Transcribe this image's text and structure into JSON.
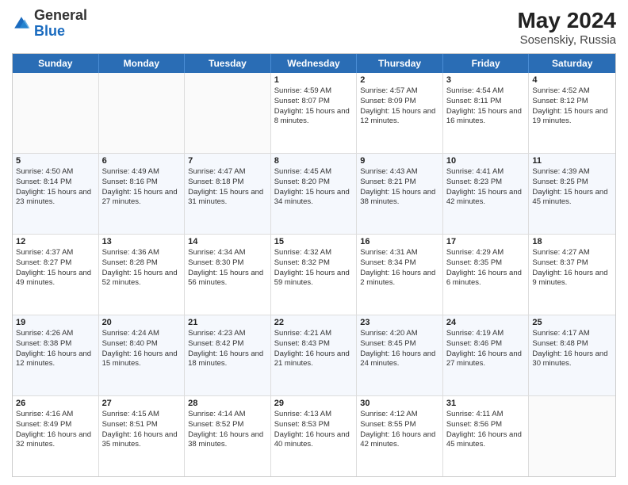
{
  "header": {
    "logo_general": "General",
    "logo_blue": "Blue",
    "month_year": "May 2024",
    "location": "Sosenskiy, Russia"
  },
  "calendar": {
    "days_of_week": [
      "Sunday",
      "Monday",
      "Tuesday",
      "Wednesday",
      "Thursday",
      "Friday",
      "Saturday"
    ],
    "rows": [
      {
        "alt": false,
        "cells": [
          {
            "day": "",
            "empty": true
          },
          {
            "day": "",
            "empty": true
          },
          {
            "day": "",
            "empty": true
          },
          {
            "day": "1",
            "sunrise": "4:59 AM",
            "sunset": "8:07 PM",
            "daylight": "15 hours and 8 minutes."
          },
          {
            "day": "2",
            "sunrise": "4:57 AM",
            "sunset": "8:09 PM",
            "daylight": "15 hours and 12 minutes."
          },
          {
            "day": "3",
            "sunrise": "4:54 AM",
            "sunset": "8:11 PM",
            "daylight": "15 hours and 16 minutes."
          },
          {
            "day": "4",
            "sunrise": "4:52 AM",
            "sunset": "8:12 PM",
            "daylight": "15 hours and 19 minutes."
          }
        ]
      },
      {
        "alt": true,
        "cells": [
          {
            "day": "5",
            "sunrise": "4:50 AM",
            "sunset": "8:14 PM",
            "daylight": "15 hours and 23 minutes."
          },
          {
            "day": "6",
            "sunrise": "4:49 AM",
            "sunset": "8:16 PM",
            "daylight": "15 hours and 27 minutes."
          },
          {
            "day": "7",
            "sunrise": "4:47 AM",
            "sunset": "8:18 PM",
            "daylight": "15 hours and 31 minutes."
          },
          {
            "day": "8",
            "sunrise": "4:45 AM",
            "sunset": "8:20 PM",
            "daylight": "15 hours and 34 minutes."
          },
          {
            "day": "9",
            "sunrise": "4:43 AM",
            "sunset": "8:21 PM",
            "daylight": "15 hours and 38 minutes."
          },
          {
            "day": "10",
            "sunrise": "4:41 AM",
            "sunset": "8:23 PM",
            "daylight": "15 hours and 42 minutes."
          },
          {
            "day": "11",
            "sunrise": "4:39 AM",
            "sunset": "8:25 PM",
            "daylight": "15 hours and 45 minutes."
          }
        ]
      },
      {
        "alt": false,
        "cells": [
          {
            "day": "12",
            "sunrise": "4:37 AM",
            "sunset": "8:27 PM",
            "daylight": "15 hours and 49 minutes."
          },
          {
            "day": "13",
            "sunrise": "4:36 AM",
            "sunset": "8:28 PM",
            "daylight": "15 hours and 52 minutes."
          },
          {
            "day": "14",
            "sunrise": "4:34 AM",
            "sunset": "8:30 PM",
            "daylight": "15 hours and 56 minutes."
          },
          {
            "day": "15",
            "sunrise": "4:32 AM",
            "sunset": "8:32 PM",
            "daylight": "15 hours and 59 minutes."
          },
          {
            "day": "16",
            "sunrise": "4:31 AM",
            "sunset": "8:34 PM",
            "daylight": "16 hours and 2 minutes."
          },
          {
            "day": "17",
            "sunrise": "4:29 AM",
            "sunset": "8:35 PM",
            "daylight": "16 hours and 6 minutes."
          },
          {
            "day": "18",
            "sunrise": "4:27 AM",
            "sunset": "8:37 PM",
            "daylight": "16 hours and 9 minutes."
          }
        ]
      },
      {
        "alt": true,
        "cells": [
          {
            "day": "19",
            "sunrise": "4:26 AM",
            "sunset": "8:38 PM",
            "daylight": "16 hours and 12 minutes."
          },
          {
            "day": "20",
            "sunrise": "4:24 AM",
            "sunset": "8:40 PM",
            "daylight": "16 hours and 15 minutes."
          },
          {
            "day": "21",
            "sunrise": "4:23 AM",
            "sunset": "8:42 PM",
            "daylight": "16 hours and 18 minutes."
          },
          {
            "day": "22",
            "sunrise": "4:21 AM",
            "sunset": "8:43 PM",
            "daylight": "16 hours and 21 minutes."
          },
          {
            "day": "23",
            "sunrise": "4:20 AM",
            "sunset": "8:45 PM",
            "daylight": "16 hours and 24 minutes."
          },
          {
            "day": "24",
            "sunrise": "4:19 AM",
            "sunset": "8:46 PM",
            "daylight": "16 hours and 27 minutes."
          },
          {
            "day": "25",
            "sunrise": "4:17 AM",
            "sunset": "8:48 PM",
            "daylight": "16 hours and 30 minutes."
          }
        ]
      },
      {
        "alt": false,
        "cells": [
          {
            "day": "26",
            "sunrise": "4:16 AM",
            "sunset": "8:49 PM",
            "daylight": "16 hours and 32 minutes."
          },
          {
            "day": "27",
            "sunrise": "4:15 AM",
            "sunset": "8:51 PM",
            "daylight": "16 hours and 35 minutes."
          },
          {
            "day": "28",
            "sunrise": "4:14 AM",
            "sunset": "8:52 PM",
            "daylight": "16 hours and 38 minutes."
          },
          {
            "day": "29",
            "sunrise": "4:13 AM",
            "sunset": "8:53 PM",
            "daylight": "16 hours and 40 minutes."
          },
          {
            "day": "30",
            "sunrise": "4:12 AM",
            "sunset": "8:55 PM",
            "daylight": "16 hours and 42 minutes."
          },
          {
            "day": "31",
            "sunrise": "4:11 AM",
            "sunset": "8:56 PM",
            "daylight": "16 hours and 45 minutes."
          },
          {
            "day": "",
            "empty": true
          }
        ]
      }
    ]
  }
}
